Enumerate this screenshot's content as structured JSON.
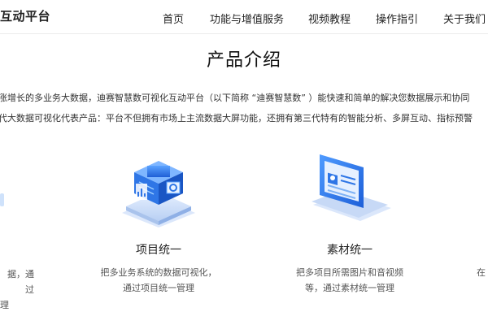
{
  "header": {
    "brand": "互动平台",
    "nav": [
      "首页",
      "功能与增值服务",
      "视频教程",
      "操作指引",
      "关于我们"
    ]
  },
  "main": {
    "title": "产品介绍",
    "intro": [
      "涨增长的多业务大数据，迪赛智慧数可视化互动平台（以下简称 “迪赛智慧数” ）能快速和简单的解决您数据展示和协同",
      "代大数据可视化代表产品：平台不但拥有市场上主流数据大屏功能，还拥有第三代特有的智能分析、多屏互动、指标预警"
    ],
    "features": [
      {
        "title": "",
        "desc": [
          "据，通过",
          "理"
        ],
        "icon": "partial-icon"
      },
      {
        "title": "项目统一",
        "desc": [
          "把多业务系统的数据可视化，",
          "通过项目统一管理"
        ],
        "icon": "chip-server-icon"
      },
      {
        "title": "素材统一",
        "desc": [
          "把多项目所需图片和音视频",
          "等，通过素材统一管理"
        ],
        "icon": "laptop-media-icon"
      },
      {
        "title": "",
        "desc": [
          "在"
        ],
        "icon": ""
      }
    ]
  }
}
